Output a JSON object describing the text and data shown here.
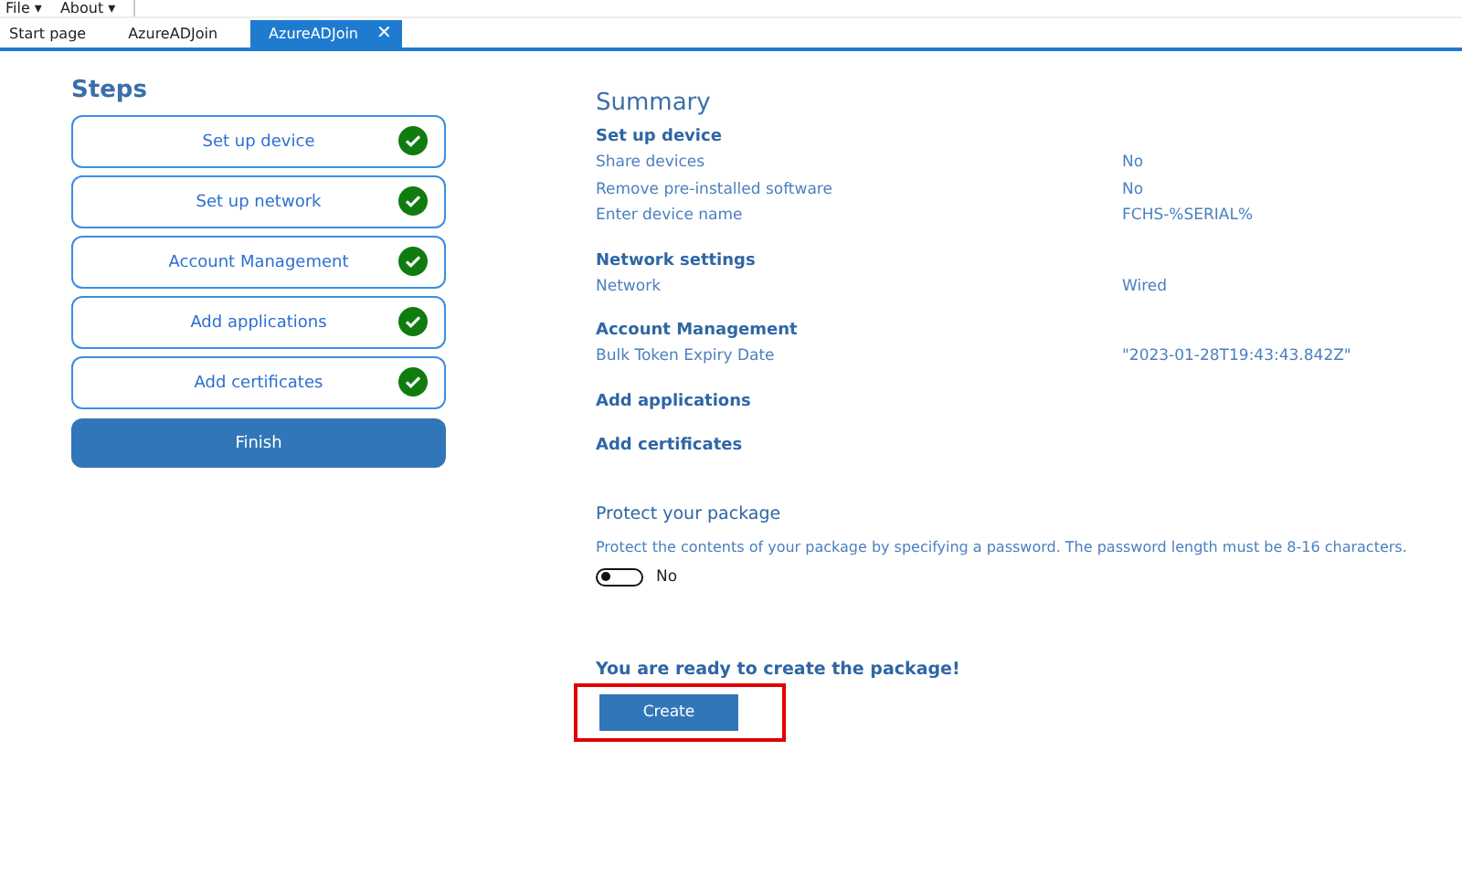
{
  "menu": [
    {
      "label": "File",
      "caret": "▾"
    },
    {
      "label": "About",
      "caret": "▾"
    }
  ],
  "tabs": [
    {
      "label": "Start page",
      "selected": false
    },
    {
      "label": "AzureADJoin",
      "selected": false
    },
    {
      "label": "AzureADJoin",
      "selected": true,
      "close": "✕"
    }
  ],
  "steps": {
    "title": "Steps",
    "items": [
      {
        "label": "Set up device",
        "done": true
      },
      {
        "label": "Set up network",
        "done": true
      },
      {
        "label": "Account Management",
        "done": true
      },
      {
        "label": "Add applications",
        "done": true
      },
      {
        "label": "Add certificates",
        "done": true
      }
    ],
    "finish": "Finish"
  },
  "summary": {
    "title": "Summary",
    "sections": [
      {
        "heading": "Set up device",
        "rows": [
          {
            "label": "Share devices",
            "value": "No"
          },
          {
            "label": "Remove pre-installed software",
            "value": "No"
          },
          {
            "label": "Enter device name",
            "value": "FCHS-%SERIAL%"
          }
        ]
      },
      {
        "heading": "Network settings",
        "rows": [
          {
            "label": "Network",
            "value": "Wired"
          }
        ]
      },
      {
        "heading": "Account Management",
        "rows": [
          {
            "label": "Bulk Token Expiry Date",
            "value": "\"2023-01-28T19:43:43.842Z\""
          }
        ]
      },
      {
        "heading": "Add applications"
      },
      {
        "heading": "Add certificates"
      }
    ]
  },
  "protect": {
    "title": "Protect your package",
    "description": "Protect the contents of your package by specifying a password. The password length must be 8-16 characters.",
    "toggle": {
      "on": false,
      "label": "No"
    }
  },
  "ready": {
    "message": "You are ready to create the package!",
    "button": "Create",
    "highlighted": true
  }
}
